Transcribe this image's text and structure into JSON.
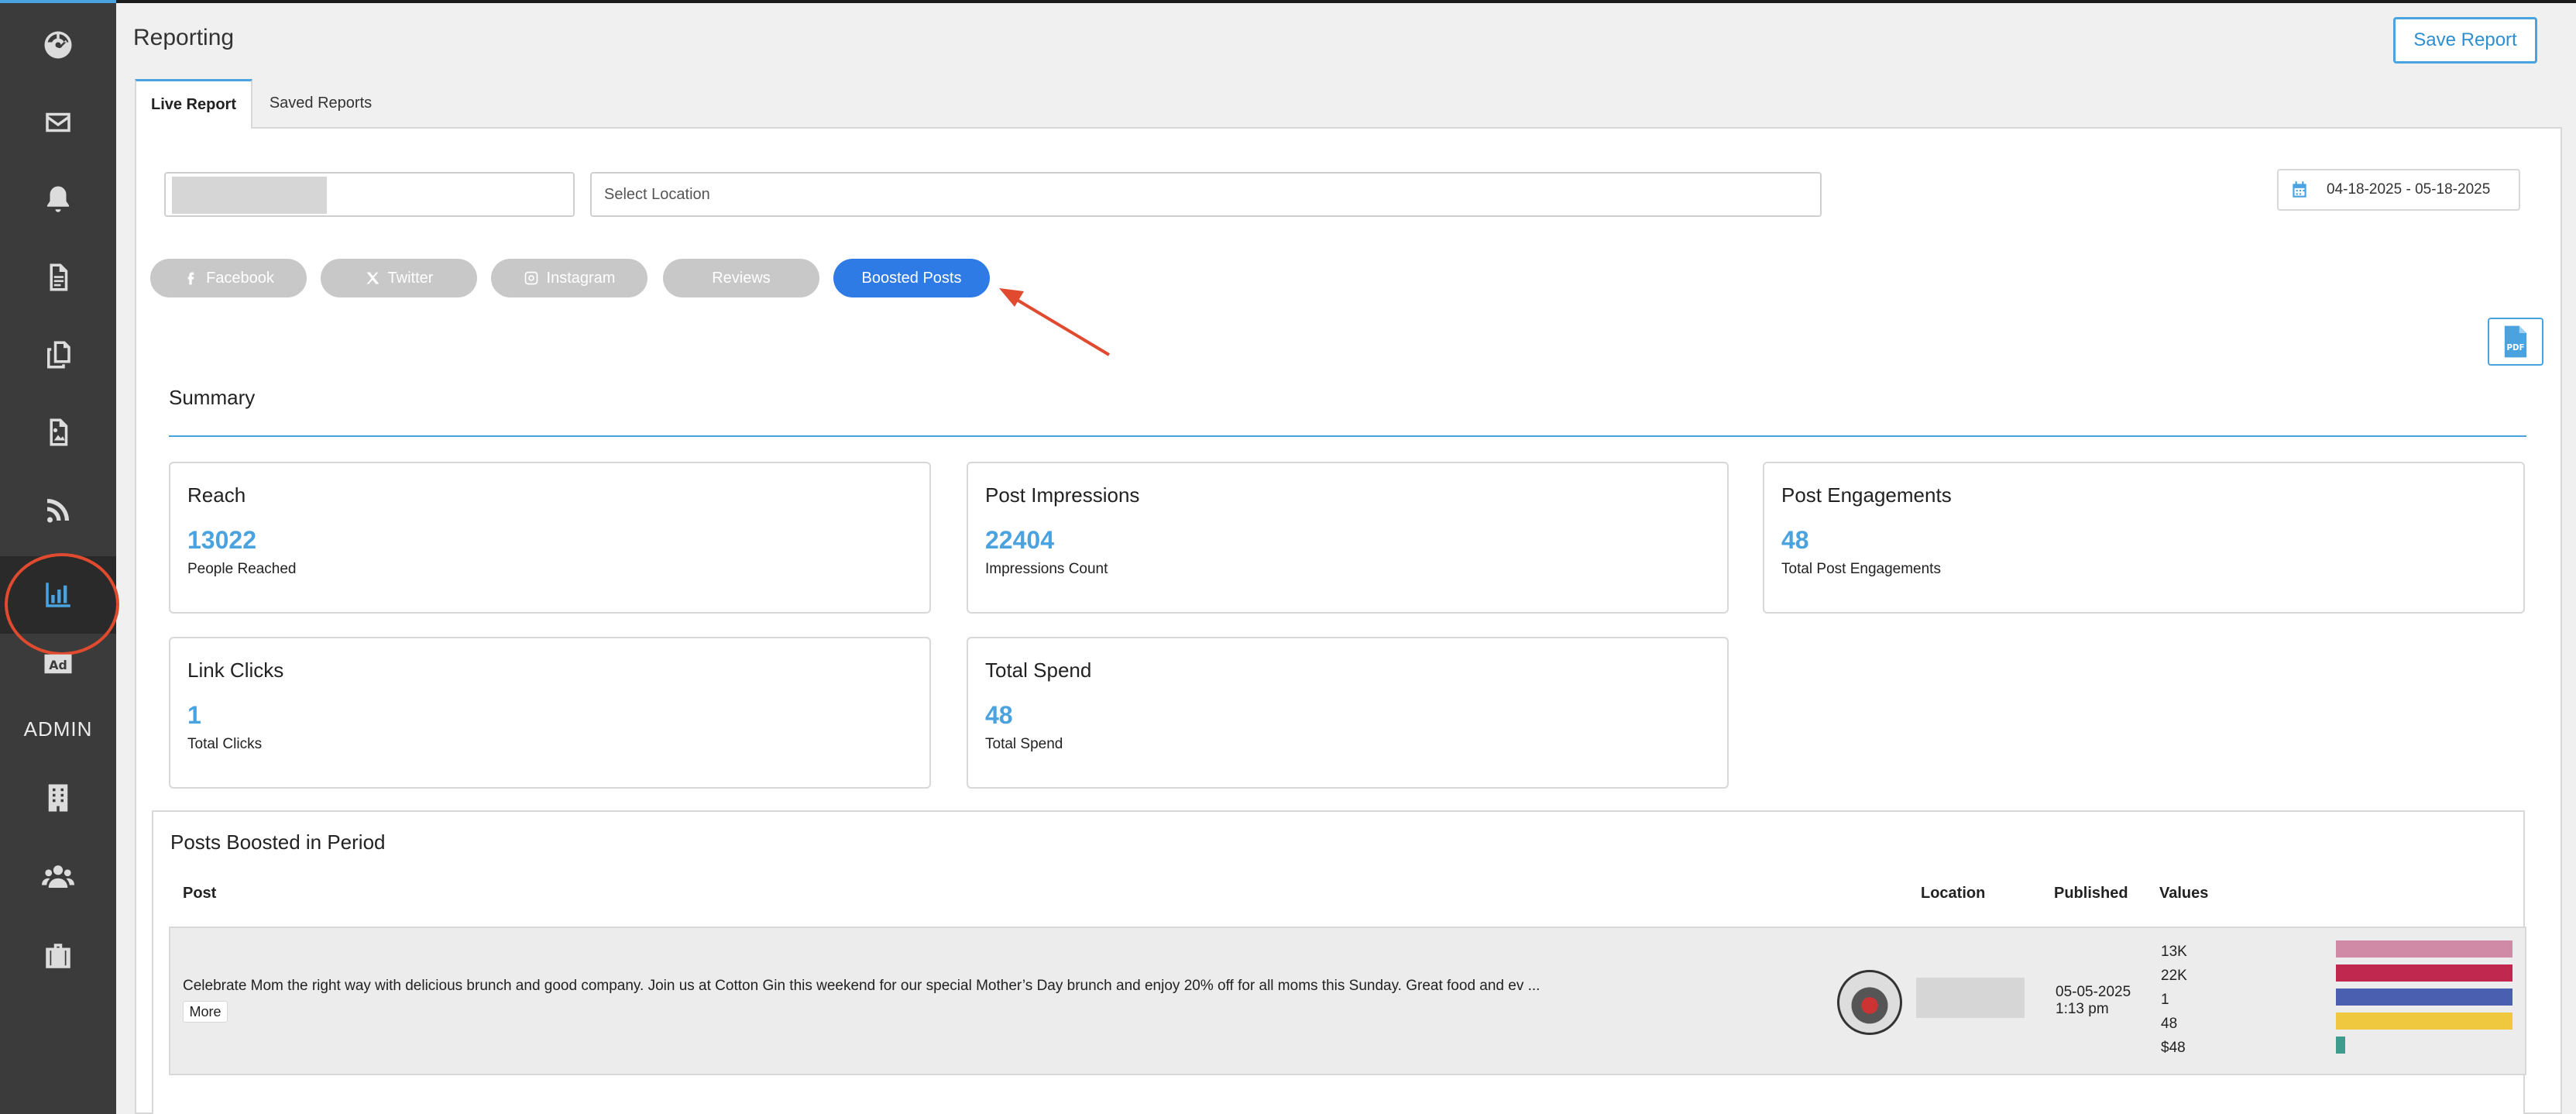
{
  "header": {
    "title": "Reporting",
    "save_label": "Save Report"
  },
  "sidebar": {
    "items": [
      "dashboard-icon",
      "inbox-icon",
      "bell-icon",
      "document-icon",
      "copy-icon",
      "image-icon",
      "rss-icon",
      "bar-chart-icon",
      "ad-icon",
      "building-icon",
      "users-icon",
      "briefcase-icon"
    ],
    "admin_label": "ADMIN"
  },
  "tabs": [
    {
      "label": "Live Report",
      "active": true
    },
    {
      "label": "Saved Reports",
      "active": false
    }
  ],
  "filters": {
    "location_placeholder": "Select Location",
    "date_range": "04-18-2025 - 05-18-2025"
  },
  "platforms": [
    {
      "label": "Facebook",
      "icon": "facebook-icon",
      "active": false
    },
    {
      "label": "Twitter",
      "icon": "x-icon",
      "active": false
    },
    {
      "label": "Instagram",
      "icon": "instagram-icon",
      "active": false
    },
    {
      "label": "Reviews",
      "icon": "",
      "active": false
    },
    {
      "label": "Boosted Posts",
      "icon": "",
      "active": true
    }
  ],
  "summary": {
    "title": "Summary",
    "cards": [
      {
        "title": "Reach",
        "value": "13022",
        "sub": "People Reached"
      },
      {
        "title": "Post Impressions",
        "value": "22404",
        "sub": "Impressions Count"
      },
      {
        "title": "Post Engagements",
        "value": "48",
        "sub": "Total Post Engagements"
      },
      {
        "title": "Link Clicks",
        "value": "1",
        "sub": "Total Clicks"
      },
      {
        "title": "Total Spend",
        "value": "48",
        "sub": "Total Spend"
      }
    ]
  },
  "posts": {
    "title": "Posts Boosted in Period",
    "columns": {
      "post": "Post",
      "location": "Location",
      "published": "Published",
      "values": "Values"
    },
    "rows": [
      {
        "text": "Celebrate Mom the right way with delicious brunch and good company. Join us at Cotton Gin this weekend for our special Mother’s Day brunch and enjoy 20% off for all moms this Sunday. Great food and ev ...",
        "more_label": "More",
        "published_date": "05-05-2025",
        "published_time": "1:13 pm",
        "values": [
          {
            "label": "13K",
            "fraction": 1.0,
            "color": "#d08aa6"
          },
          {
            "label": "22K",
            "fraction": 1.0,
            "color": "#c0284f"
          },
          {
            "label": "1",
            "fraction": 1.0,
            "color": "#4a5fb0"
          },
          {
            "label": "48",
            "fraction": 1.0,
            "color": "#f0c840"
          },
          {
            "label": "$48",
            "fraction": 0.05,
            "color": "#3d9c8c"
          }
        ]
      }
    ]
  },
  "colors": {
    "accent": "#4aa3df",
    "active_pill": "#2f7be6",
    "annotation": "#e04a2f"
  }
}
